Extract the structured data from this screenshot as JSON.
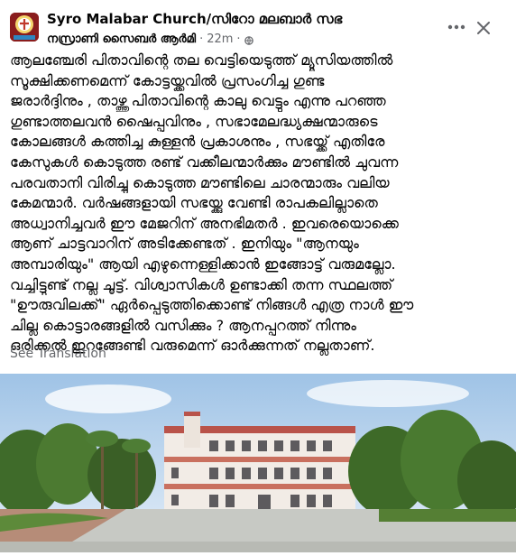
{
  "post": {
    "group_name": "Syro Malabar Church/സിറോ മലബാർ സഭ",
    "author": "നസ്രാണി സൈബർ ആർമി",
    "separator": "·",
    "time": "22m",
    "separator2": "·",
    "body_lines": [
      "ആലഞ്ചേരി പിതാവിന്റെ തല വെട്ടിയെടുത്ത് മ്യൂസിയത്തിൽ",
      "സൂക്ഷിക്കണമെന്ന് കോട്ടയ്ക്കവിൽ പ്രസംഗിച്ച ഗുണ്ട",
      "ജരാർദ്ദിനും , താഴ്ത്തു പിതാവിന്റെ കാലു വെട്ടും എന്നു പറഞ്ഞ",
      "ഗുണ്ടാത്തലവൻ ഷൈപ്പുവിനും , സഭാമേലദ്ധ്യക്ഷന്മാരുടെ",
      "കോലങ്ങൾ കത്തിച്ച കുള്ളൻ പ്രകാശനും , സഭയ്ക്ക് എതിരേ",
      "കേസുകൾ കൊടുത്ത രണ്ട് വക്കീലന്മാർക്കും മൗണ്ടിൽ ചുവന്ന",
      "പരവതാനി വിരിച്ചു കൊടുത്ത മൗണ്ടിലെ ചാരന്മാരും വലിയ",
      "കേമന്മാർ. വർഷങ്ങളായി സഭയ്ക്കു വേണ്ടി രാപകലില്ലാതെ",
      "അധ്വാനിച്ചവർ ഈ മേജറിന് അനഭിമതർ . ഇവരെയൊക്കെ",
      "ആണ് ചാട്ടവാറിന് അടിക്കേണ്ടത് . ഇനിയും \"ആനയും",
      "അമ്പാരിയും\" ആയി എഴുന്നെള്ളിക്കാൻ ഇങ്ങോട്ട് വരുമല്ലോ.",
      "വച്ചിട്ടുണ്ട് നല്ല ചൂട്ട്. വിശ്വാസികൾ ഉണ്ടാക്കി തന്ന സ്ഥലത്ത്",
      "\"ഊരുവിലക്ക്\" ഏർപ്പെടുത്തിക്കൊണ്ട് നിങ്ങൾ എത്ര നാൾ ഈ",
      "ചില്ലു കൊട്ടാരങ്ങളിൽ വസിക്കും ? ആനപ്പുറത്ത് നിന്നും",
      "ഒരിക്കൽ ഇറങ്ങേണ്ടി വരുമെന്ന് ഓർക്കുന്നത് നല്ലതാണ്."
    ],
    "see_translation": "See Translation"
  },
  "icons": {
    "avatar": "church-logo",
    "globe": "globe-icon",
    "more": "more-horizontal-icon",
    "close": "close-icon"
  },
  "colors": {
    "text": "#050505",
    "secondary_text": "#65676b",
    "avatar_bg": "#8a1d1d"
  }
}
